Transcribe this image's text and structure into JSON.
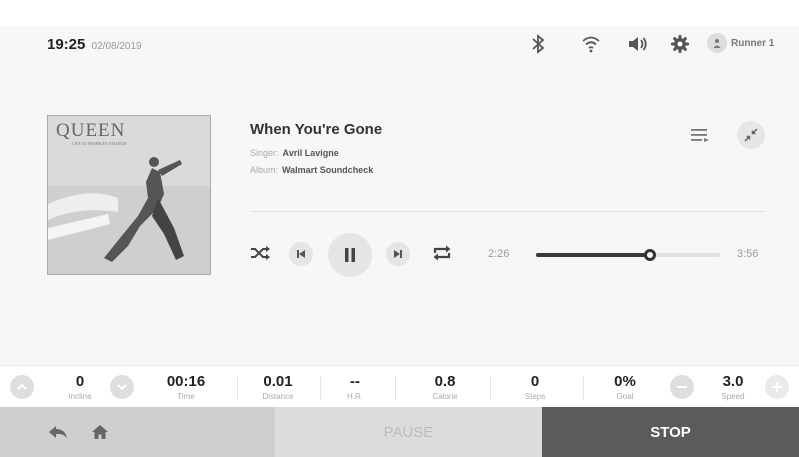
{
  "header": {
    "time": "19:25",
    "date": "02/08/2019",
    "user_name": "Runner 1",
    "icons": [
      "bluetooth-icon",
      "wifi-icon",
      "volume-icon",
      "gear-icon",
      "user-icon"
    ]
  },
  "player": {
    "album_art_text": "QUEEN",
    "album_art_subtext": "LIVE AT WEMBLEY STADIUM",
    "title": "When You're Gone",
    "singer_label": "Singer:",
    "singer": "Avril Lavigne",
    "album_label": "Album:",
    "album": "Walmart Soundcheck",
    "current_time": "2:26",
    "total_time": "3:56",
    "progress_fraction": 0.62,
    "icons": [
      "playlist-icon",
      "collapse-icon",
      "shuffle-icon",
      "previous-icon",
      "pause-icon",
      "next-icon",
      "repeat-icon"
    ]
  },
  "stats": {
    "incline": {
      "value": "0",
      "label": "Incline"
    },
    "time": {
      "value": "00:16",
      "label": "Time"
    },
    "distance": {
      "value": "0.01",
      "label": "Distance"
    },
    "hr": {
      "value": "--",
      "label": "H.R."
    },
    "calorie": {
      "value": "0.8",
      "label": "Calorie"
    },
    "steps": {
      "value": "0",
      "label": "Steps"
    },
    "goal": {
      "value": "0%",
      "label": "Goal"
    },
    "speed": {
      "value": "3.0",
      "label": "Speed"
    }
  },
  "bottom": {
    "pause_label": "PAUSE",
    "stop_label": "STOP",
    "icons": [
      "back-icon",
      "home-icon"
    ]
  },
  "colors": {
    "stop_bg": "#5b5b5b",
    "pause_bg": "#dcdcdc",
    "accent_dark": "#333333"
  }
}
